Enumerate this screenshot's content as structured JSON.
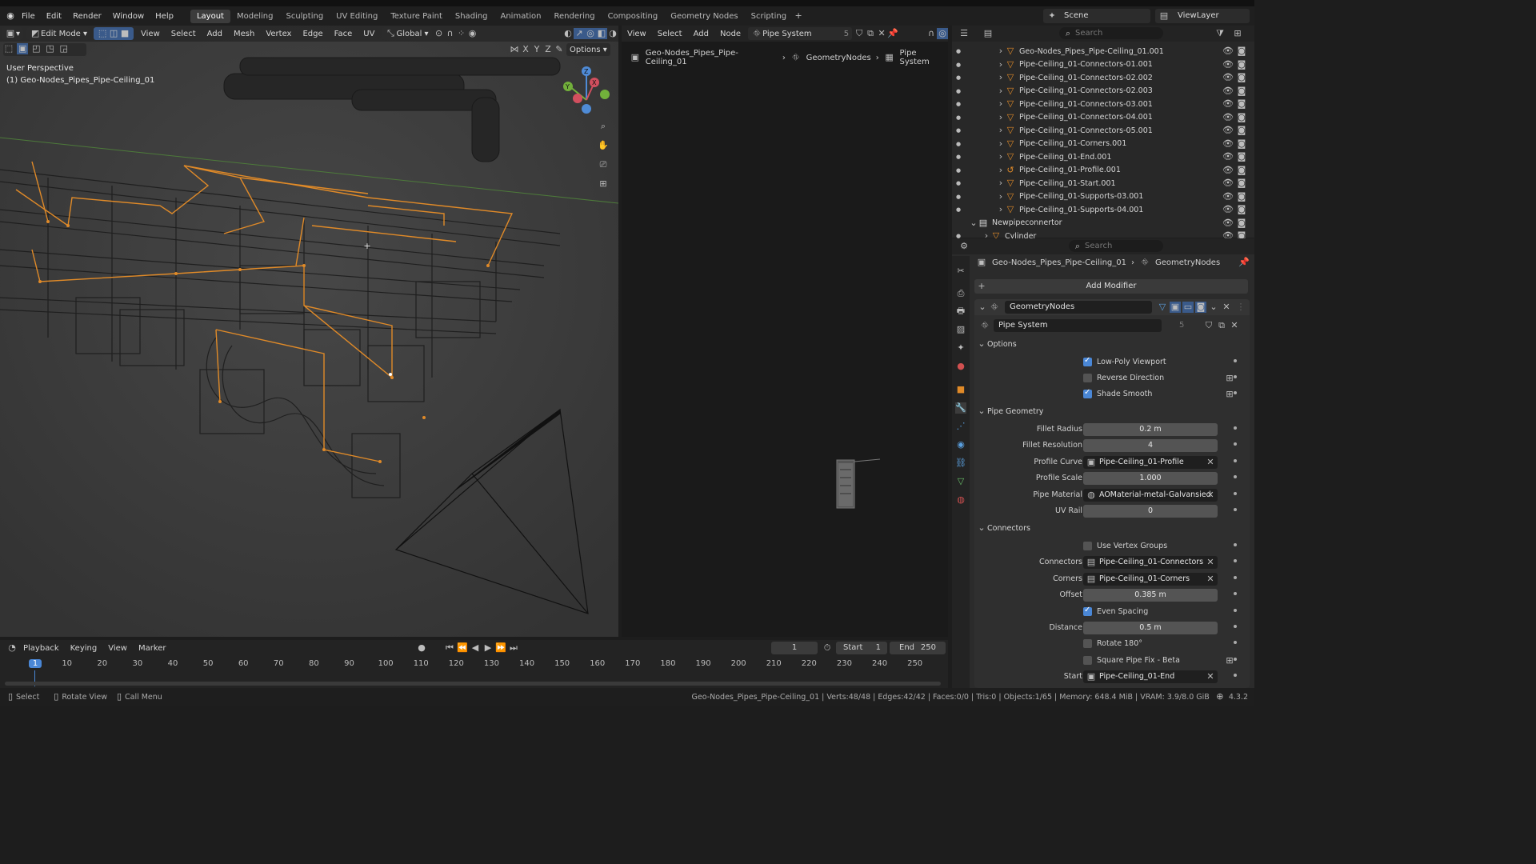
{
  "menubar": {
    "items": [
      "File",
      "Edit",
      "Render",
      "Window",
      "Help"
    ],
    "workspaces": [
      "Layout",
      "Modeling",
      "Sculpting",
      "UV Editing",
      "Texture Paint",
      "Shading",
      "Animation",
      "Rendering",
      "Compositing",
      "Geometry Nodes",
      "Scripting"
    ],
    "active_workspace": "Layout",
    "scene": "Scene",
    "view_layer": "ViewLayer"
  },
  "viewport": {
    "mode": "Edit Mode",
    "menus": [
      "View",
      "Select",
      "Add",
      "Mesh",
      "Vertex",
      "Edge",
      "Face",
      "UV"
    ],
    "transform_orientation": "Global",
    "options": "Options",
    "overlay_title": "User Perspective",
    "overlay_object": "(1) Geo-Nodes_Pipes_Pipe-Ceiling_01",
    "axes": [
      "X",
      "Y",
      "Z"
    ]
  },
  "node_editor": {
    "menus": [
      "View",
      "Select",
      "Add",
      "Node"
    ],
    "tree_name": "Pipe System",
    "users": "5",
    "breadcrumb": [
      "Geo-Nodes_Pipes_Pipe-Ceiling_01",
      "GeometryNodes",
      "Pipe System"
    ]
  },
  "outliner": {
    "search_placeholder": "Search",
    "rows": [
      "Geo-Nodes_Pipes_Pipe-Ceiling_01.001",
      "Pipe-Ceiling_01-Connectors-01.001",
      "Pipe-Ceiling_01-Connectors-02.002",
      "Pipe-Ceiling_01-Connectors-02.003",
      "Pipe-Ceiling_01-Connectors-03.001",
      "Pipe-Ceiling_01-Connectors-04.001",
      "Pipe-Ceiling_01-Connectors-05.001",
      "Pipe-Ceiling_01-Corners.001",
      "Pipe-Ceiling_01-End.001",
      "Pipe-Ceiling_01-Profile.001",
      "Pipe-Ceiling_01-Start.001",
      "Pipe-Ceiling_01-Supports-03.001",
      "Pipe-Ceiling_01-Supports-04.001",
      "Newpipeconnertor",
      "Cylinder"
    ]
  },
  "properties": {
    "search_placeholder": "Search",
    "breadcrumb": [
      "Geo-Nodes_Pipes_Pipe-Ceiling_01",
      "GeometryNodes"
    ],
    "add_modifier": "Add Modifier",
    "modifier_name": "GeometryNodes",
    "node_group": "Pipe System",
    "users": "5",
    "sections": {
      "options": "Options",
      "geometry": "Pipe Geometry",
      "connectors": "Connectors"
    },
    "low_poly": "Low-Poly Viewport",
    "reverse": "Reverse Direction",
    "shade_smooth": "Shade Smooth",
    "fillet_radius_label": "Fillet Radius",
    "fillet_radius": "0.2 m",
    "fillet_res_label": "Fillet Resolution",
    "fillet_res": "4",
    "profile_curve_label": "Profile Curve",
    "profile_curve": "Pipe-Ceiling_01-Profile",
    "profile_scale_label": "Profile Scale",
    "profile_scale": "1.000",
    "pipe_material_label": "Pipe Material",
    "pipe_material": "AOMaterial-metal-Galvansied",
    "uv_rail_label": "UV Rail",
    "uv_rail": "0",
    "use_vg": "Use Vertex Groups",
    "connectors_label": "Connectors",
    "connectors": "Pipe-Ceiling_01-Connectors",
    "corners_label": "Corners",
    "corners": "Pipe-Ceiling_01-Corners",
    "offset_label": "Offset",
    "offset": "0.385 m",
    "even_spacing": "Even Spacing",
    "distance_label": "Distance",
    "distance": "0.5 m",
    "rotate": "Rotate 180°",
    "square_fix": "Square Pipe Fix - Beta",
    "start_label": "Start",
    "start": "Pipe-Ceiling_01-End"
  },
  "timeline": {
    "menus": [
      "Playback",
      "Keying",
      "View",
      "Marker"
    ],
    "current_frame": "1",
    "start_label": "Start",
    "start": "1",
    "end_label": "End",
    "end": "250",
    "ticks": [
      "1",
      "10",
      "20",
      "30",
      "40",
      "50",
      "60",
      "70",
      "80",
      "90",
      "100",
      "110",
      "120",
      "130",
      "140",
      "150",
      "160",
      "170",
      "180",
      "190",
      "200",
      "210",
      "220",
      "230",
      "240",
      "250"
    ]
  },
  "statusbar": {
    "select": "Select",
    "rotate": "Rotate View",
    "menu": "Call Menu",
    "stats": "Geo-Nodes_Pipes_Pipe-Ceiling_01 | Verts:48/48 | Edges:42/42 | Faces:0/0 | Tris:0 | Objects:1/65 | Memory: 648.4 MiB | VRAM: 3.9/8.0 GiB",
    "version": "4.3.2"
  }
}
